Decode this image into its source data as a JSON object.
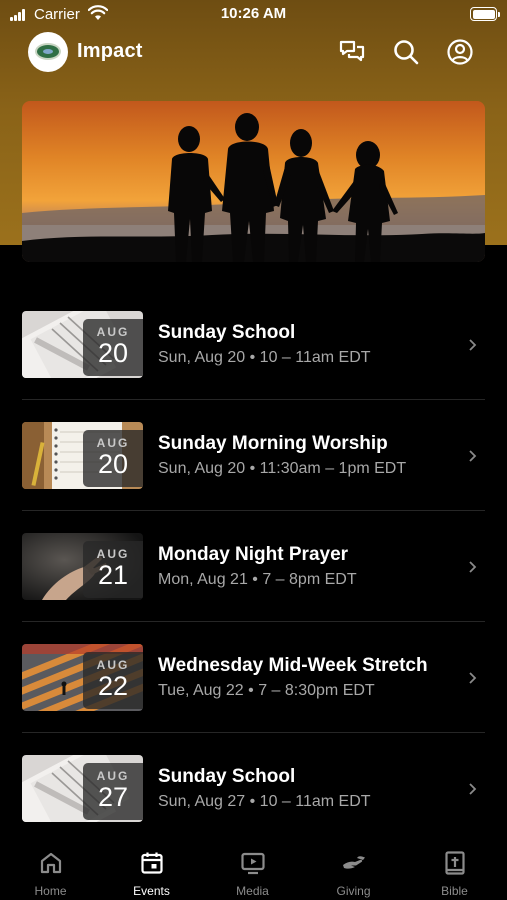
{
  "status_bar": {
    "carrier": "Carrier",
    "time": "10:26 AM"
  },
  "header": {
    "title": "Impact",
    "icons": [
      "chat-bubbles-icon",
      "search-icon",
      "profile-icon"
    ]
  },
  "events": [
    {
      "title": "Sunday School",
      "meta": "Sun, Aug 20 • 10 – 11am EDT",
      "month": "AUG",
      "day": "20",
      "thumb": "notebook"
    },
    {
      "title": "Sunday Morning Worship",
      "meta": "Sun, Aug 20 • 11:30am – 1pm EDT",
      "month": "AUG",
      "day": "20",
      "thumb": "journal"
    },
    {
      "title": "Monday Night Prayer",
      "meta": "Mon, Aug 21 • 7 – 8pm EDT",
      "month": "AUG",
      "day": "21",
      "thumb": "hand"
    },
    {
      "title": "Wednesday Mid-Week Stretch",
      "meta": "Tue, Aug 22 • 7 – 8:30pm EDT",
      "month": "AUG",
      "day": "22",
      "thumb": "crosswalk"
    },
    {
      "title": "Sunday School",
      "meta": "Sun, Aug 27 • 10 – 11am EDT",
      "month": "AUG",
      "day": "27",
      "thumb": "notebook"
    }
  ],
  "tabs": [
    {
      "label": "Home",
      "icon": "home-icon",
      "active": false
    },
    {
      "label": "Events",
      "icon": "calendar-icon",
      "active": true
    },
    {
      "label": "Media",
      "icon": "play-screen-icon",
      "active": false
    },
    {
      "label": "Giving",
      "icon": "giving-hand-icon",
      "active": false
    },
    {
      "label": "Bible",
      "icon": "bible-icon",
      "active": false
    }
  ],
  "colors": {
    "header_gradient_top": "#6e4d12",
    "header_gradient_bottom": "#9b711c",
    "background": "#000000",
    "secondary_text": "#a8a8a8",
    "inactive_tab": "#8c8c8c"
  }
}
